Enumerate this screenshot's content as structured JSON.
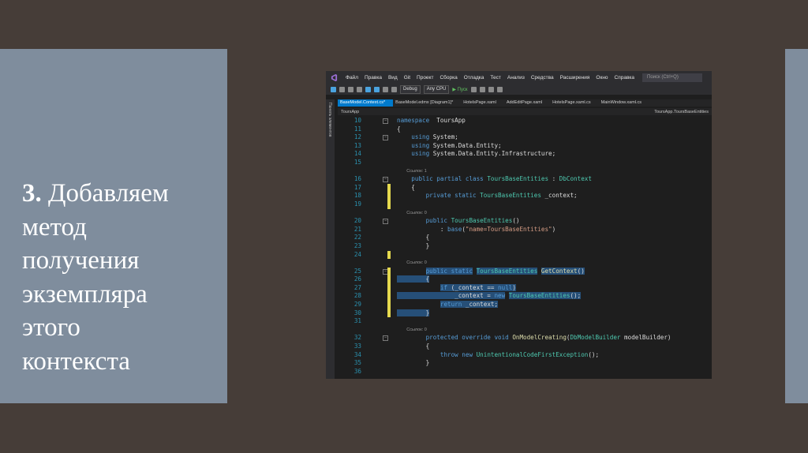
{
  "slide": {
    "number": "3.",
    "text": "Добавляем\nметод\nполучения\nэкземпляра\nэтого\nконтекста"
  },
  "ide": {
    "menu": [
      "Файл",
      "Правка",
      "Вид",
      "Git",
      "Проект",
      "Сборка",
      "Отладка",
      "Тест",
      "Анализ",
      "Средства",
      "Расширения",
      "Окно",
      "Справка"
    ],
    "search_placeholder": "Поиск (Ctrl+Q)",
    "toolbar": {
      "config": "Debug",
      "platform": "Any CPU",
      "run_label": "▶ Пуск"
    },
    "side_panel_label": "Панель элементов",
    "tabs": [
      "BaseModel.Context.cs*",
      "BaseModel.edmx [Diagram1]*",
      "HotelsPage.xaml",
      "AddEditPage.xaml",
      "HotelsPage.xaml.cs",
      "MainWindow.xaml.cs"
    ],
    "nav": {
      "left": "ToursApp",
      "right": "ToursApp.ToursBaseEntities"
    },
    "code": [
      {
        "n": "10",
        "fold": "⊟",
        "parts": [
          [
            "kw",
            "namespace"
          ],
          [
            "",
            "  ToursApp"
          ]
        ]
      },
      {
        "n": "11",
        "parts": [
          [
            "",
            "{"
          ]
        ]
      },
      {
        "n": "12",
        "fold": "⊟",
        "parts": [
          [
            "",
            "    "
          ],
          [
            "kw",
            "using"
          ],
          [
            "",
            " System;"
          ]
        ]
      },
      {
        "n": "13",
        "parts": [
          [
            "",
            "    "
          ],
          [
            "kw",
            "using"
          ],
          [
            "",
            " System.Data.Entity;"
          ]
        ]
      },
      {
        "n": "14",
        "parts": [
          [
            "",
            "    "
          ],
          [
            "kw",
            "using"
          ],
          [
            "",
            " System.Data.Entity.Infrastructure;"
          ]
        ]
      },
      {
        "n": "15",
        "parts": [
          [
            "",
            ""
          ]
        ]
      },
      {
        "meta": "Ссылок: 1"
      },
      {
        "n": "16",
        "fold": "⊟",
        "parts": [
          [
            "",
            "    "
          ],
          [
            "kw",
            "public partial class"
          ],
          [
            "",
            " "
          ],
          [
            "ty",
            "ToursBaseEntities"
          ],
          [
            "",
            " : "
          ],
          [
            "ty",
            "DbContext"
          ]
        ]
      },
      {
        "n": "17",
        "bar": "y",
        "parts": [
          [
            "",
            "    {"
          ]
        ]
      },
      {
        "n": "18",
        "bar": "y",
        "parts": [
          [
            "",
            "        "
          ],
          [
            "kw",
            "private static"
          ],
          [
            "",
            " "
          ],
          [
            "ty",
            "ToursBaseEntities"
          ],
          [
            "",
            " _context;"
          ]
        ]
      },
      {
        "n": "19",
        "bar": "y",
        "parts": [
          [
            "",
            ""
          ]
        ]
      },
      {
        "meta": "Ссылок: 0"
      },
      {
        "n": "20",
        "fold": "⊟",
        "parts": [
          [
            "",
            "        "
          ],
          [
            "kw",
            "public"
          ],
          [
            "",
            " "
          ],
          [
            "ty",
            "ToursBaseEntities"
          ],
          [
            "",
            "()"
          ]
        ]
      },
      {
        "n": "21",
        "parts": [
          [
            "",
            "            : "
          ],
          [
            "kw",
            "base"
          ],
          [
            "",
            "("
          ],
          [
            "st",
            "\"name=ToursBaseEntities\""
          ],
          [
            "",
            ")"
          ]
        ]
      },
      {
        "n": "22",
        "parts": [
          [
            "",
            "        {"
          ]
        ]
      },
      {
        "n": "23",
        "parts": [
          [
            "",
            "        }"
          ]
        ]
      },
      {
        "n": "24",
        "bar": "y",
        "parts": [
          [
            "",
            ""
          ]
        ]
      },
      {
        "meta": "Ссылок: 0"
      },
      {
        "n": "25",
        "bar": "y",
        "hl": true,
        "fold": "⊟",
        "parts": [
          [
            "",
            "        "
          ],
          [
            "kw",
            "public static"
          ],
          [
            "",
            " "
          ],
          [
            "ty",
            "ToursBaseEntities"
          ],
          [
            "",
            " "
          ],
          [
            "mt",
            "GetContext"
          ],
          [
            "",
            "()"
          ]
        ]
      },
      {
        "n": "26",
        "bar": "y",
        "hl": true,
        "parts": [
          [
            "",
            "        {"
          ]
        ]
      },
      {
        "n": "27",
        "bar": "y",
        "hl": true,
        "parts": [
          [
            "",
            "            "
          ],
          [
            "kw",
            "if"
          ],
          [
            "",
            " (_context == "
          ],
          [
            "kw",
            "null"
          ],
          [
            "",
            ")"
          ]
        ]
      },
      {
        "n": "28",
        "bar": "y",
        "hl": true,
        "parts": [
          [
            "",
            "                _context = "
          ],
          [
            "kw",
            "new"
          ],
          [
            "",
            " "
          ],
          [
            "ty",
            "ToursBaseEntities"
          ],
          [
            "",
            "();"
          ]
        ]
      },
      {
        "n": "29",
        "bar": "y",
        "hl": true,
        "parts": [
          [
            "",
            "            "
          ],
          [
            "kw",
            "return"
          ],
          [
            "",
            " _context;"
          ]
        ]
      },
      {
        "n": "30",
        "bar": "y",
        "hl": true,
        "parts": [
          [
            "",
            "        }"
          ]
        ]
      },
      {
        "n": "31",
        "parts": [
          [
            "",
            ""
          ]
        ]
      },
      {
        "meta": "Ссылок: 0"
      },
      {
        "n": "32",
        "fold": "⊟",
        "parts": [
          [
            "",
            "        "
          ],
          [
            "kw",
            "protected override void"
          ],
          [
            "",
            " "
          ],
          [
            "mt",
            "OnModelCreating"
          ],
          [
            "",
            "("
          ],
          [
            "ty",
            "DbModelBuilder"
          ],
          [
            "",
            " modelBuilder)"
          ]
        ]
      },
      {
        "n": "33",
        "parts": [
          [
            "",
            "        {"
          ]
        ]
      },
      {
        "n": "34",
        "parts": [
          [
            "",
            "            "
          ],
          [
            "kw",
            "throw new"
          ],
          [
            "",
            " "
          ],
          [
            "ty",
            "UnintentionalCodeFirstException"
          ],
          [
            "",
            "();"
          ]
        ]
      },
      {
        "n": "35",
        "parts": [
          [
            "",
            "        }"
          ]
        ]
      },
      {
        "n": "36",
        "parts": [
          [
            "",
            ""
          ]
        ]
      }
    ]
  }
}
